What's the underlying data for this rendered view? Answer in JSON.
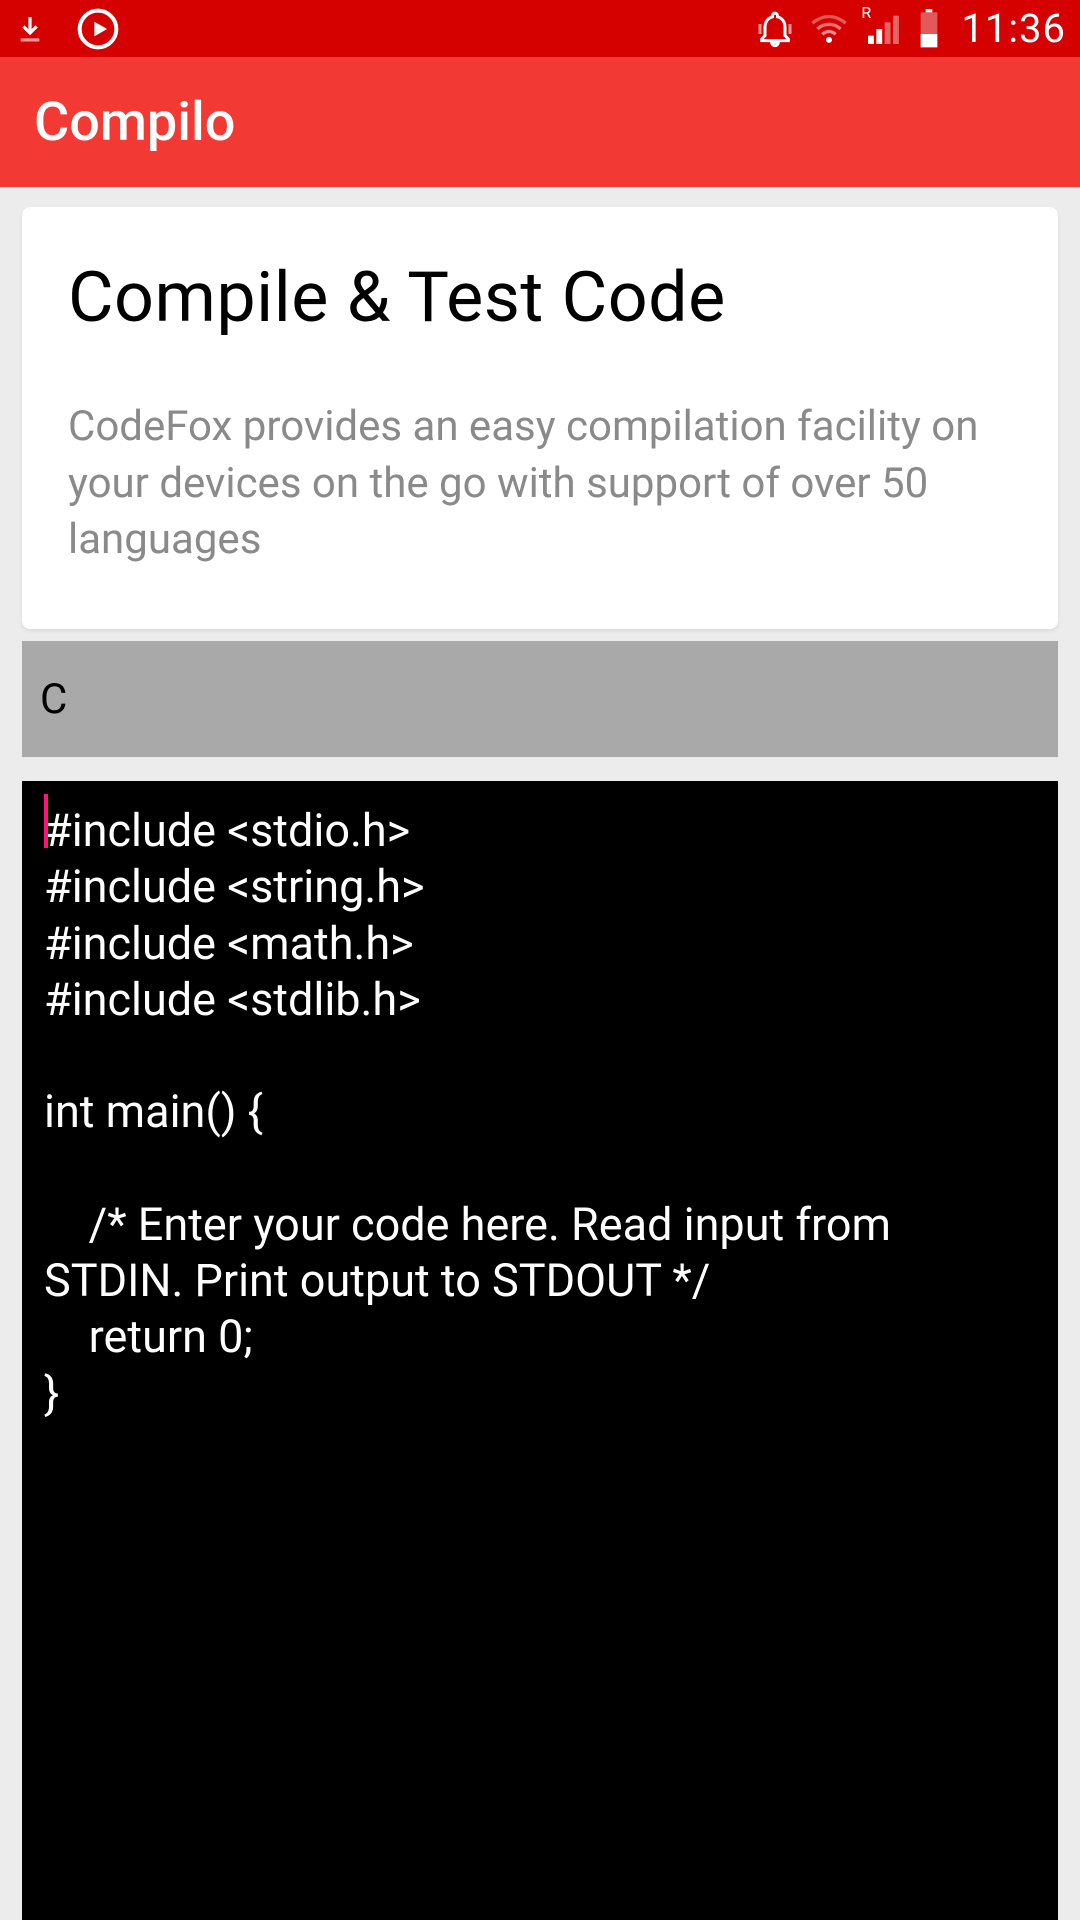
{
  "status": {
    "time": "11:36",
    "icons_left": [
      "download-icon",
      "play-circle-icon"
    ],
    "icons_right": [
      "ringer-vibrate-icon",
      "wifi-icon",
      "signal-r-icon",
      "battery-icon"
    ]
  },
  "appbar": {
    "title": "Compilo"
  },
  "main": {
    "card": {
      "title": "Compile & Test Code",
      "description": "CodeFox provides an easy compilation facility on your devices on the go with support of over 50 languages"
    },
    "language_bar": {
      "selected": "C"
    },
    "editor": {
      "code": "#include <stdio.h>\n#include <string.h>\n#include <math.h>\n#include <stdlib.h>\n\nint main() {\n\n    /* Enter your code here. Read input from STDIN. Print output to STDOUT */\n    return 0;\n}"
    }
  },
  "colors": {
    "status_bg": "#d50000",
    "appbar_bg": "#f23933",
    "page_bg": "#ececec",
    "lang_bg": "#a9a9a9",
    "editor_bg": "#000000",
    "editor_fg": "#ffffff",
    "cursor": "#ff1577"
  }
}
